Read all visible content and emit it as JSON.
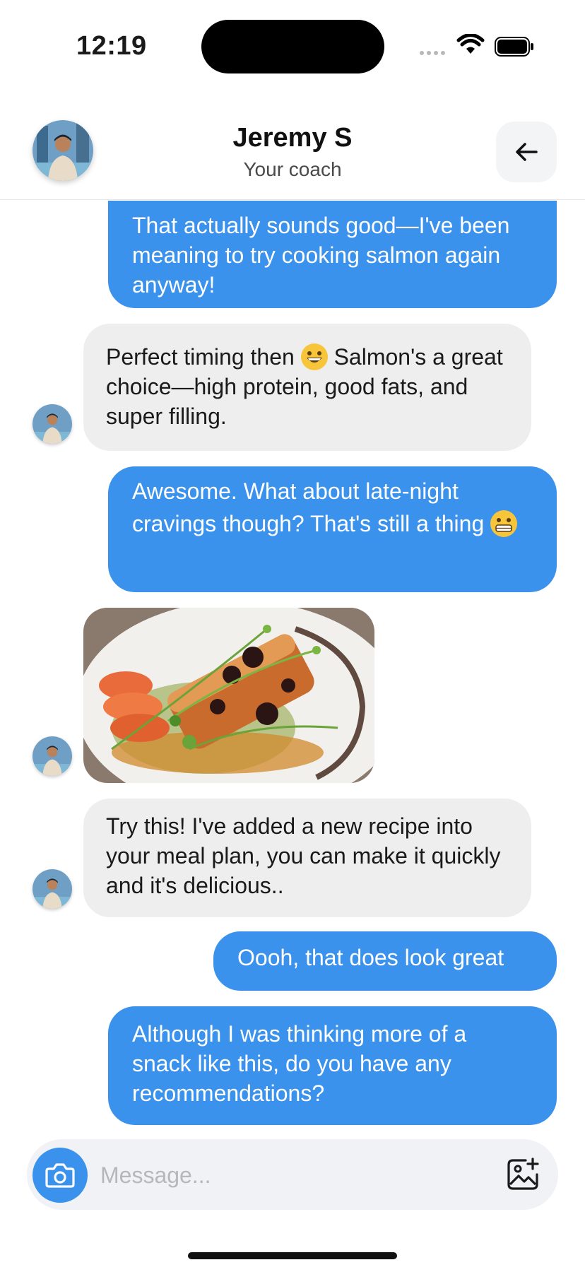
{
  "status_bar": {
    "time": "12:19"
  },
  "header": {
    "name": "Jeremy S",
    "role": "Your coach"
  },
  "messages": [
    {
      "from": "me",
      "text": "That actually sounds good—I've been meaning to try cooking salmon again anyway!"
    },
    {
      "from": "coach",
      "text_before": "Perfect timing then",
      "emoji": "grinning-face",
      "text_after": "Salmon's a great choice—high protein, good fats, and super filling."
    },
    {
      "from": "me",
      "text": "Awesome. What about late-night cravings though? That's still a thing",
      "emoji": "grimacing-face"
    },
    {
      "from": "coach",
      "type": "image",
      "image": "glazed-salmon-dish"
    },
    {
      "from": "coach",
      "text": "Try this! I've added a new recipe into your meal plan, you can make it quickly and it's delicious.."
    },
    {
      "from": "me",
      "text": "Oooh, that does look great"
    },
    {
      "from": "me",
      "text": "Although I was thinking more of a snack like this, do you have any recommendations?"
    }
  ],
  "composer": {
    "placeholder": "Message..."
  },
  "icons": {
    "back": "arrow-left-icon",
    "camera": "camera-icon",
    "gallery": "image-add-icon"
  },
  "colors": {
    "accent": "#3a92ec",
    "incoming_bubble": "#eeeeee"
  }
}
